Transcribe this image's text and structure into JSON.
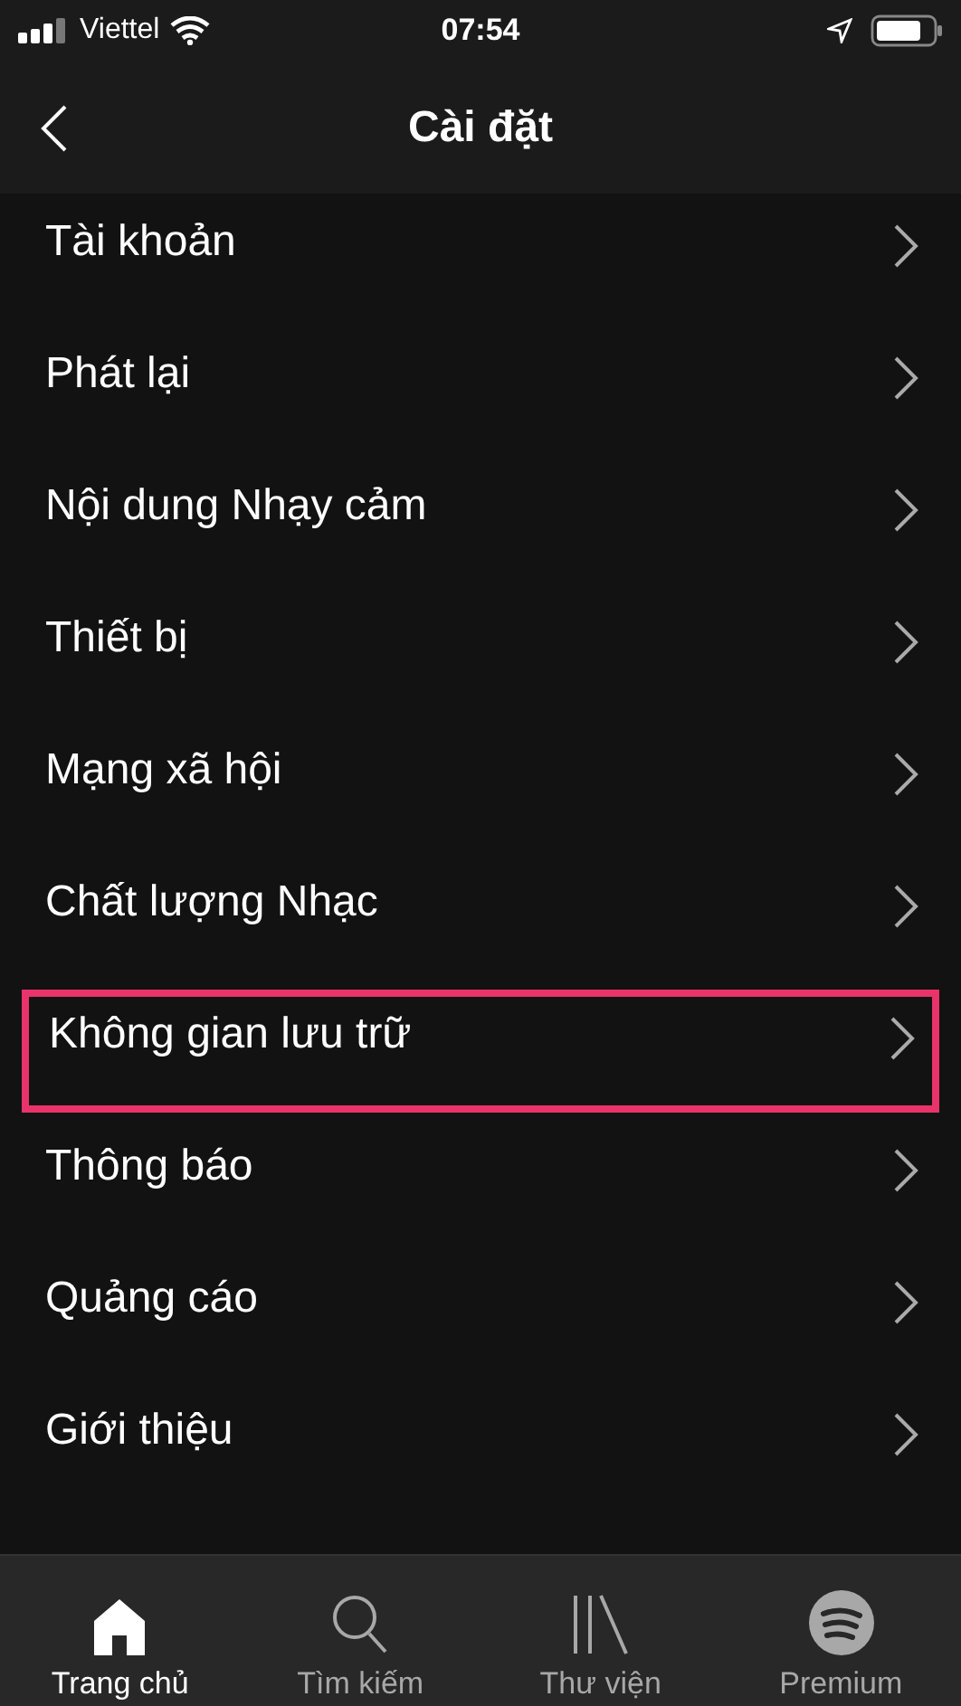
{
  "status_bar": {
    "carrier": "Viettel",
    "time": "07:54"
  },
  "header": {
    "title": "Cài đặt"
  },
  "items": [
    {
      "label": "Tài khoản",
      "highlighted": false
    },
    {
      "label": "Phát lại",
      "highlighted": false
    },
    {
      "label": "Nội dung Nhạy cảm",
      "highlighted": false
    },
    {
      "label": "Thiết bị",
      "highlighted": false
    },
    {
      "label": "Mạng xã hội",
      "highlighted": false
    },
    {
      "label": "Chất lượng Nhạc",
      "highlighted": false
    },
    {
      "label": "Không gian lưu trữ",
      "highlighted": true
    },
    {
      "label": "Thông báo",
      "highlighted": false
    },
    {
      "label": "Quảng cáo",
      "highlighted": false
    },
    {
      "label": "Giới thiệu",
      "highlighted": false
    }
  ],
  "tabs": [
    {
      "kind": "home",
      "label": "Trang chủ",
      "selected": true
    },
    {
      "kind": "search",
      "label": "Tìm kiếm",
      "selected": false
    },
    {
      "kind": "library",
      "label": "Thư viện",
      "selected": false
    },
    {
      "kind": "premium",
      "label": "Premium",
      "selected": false
    }
  ]
}
